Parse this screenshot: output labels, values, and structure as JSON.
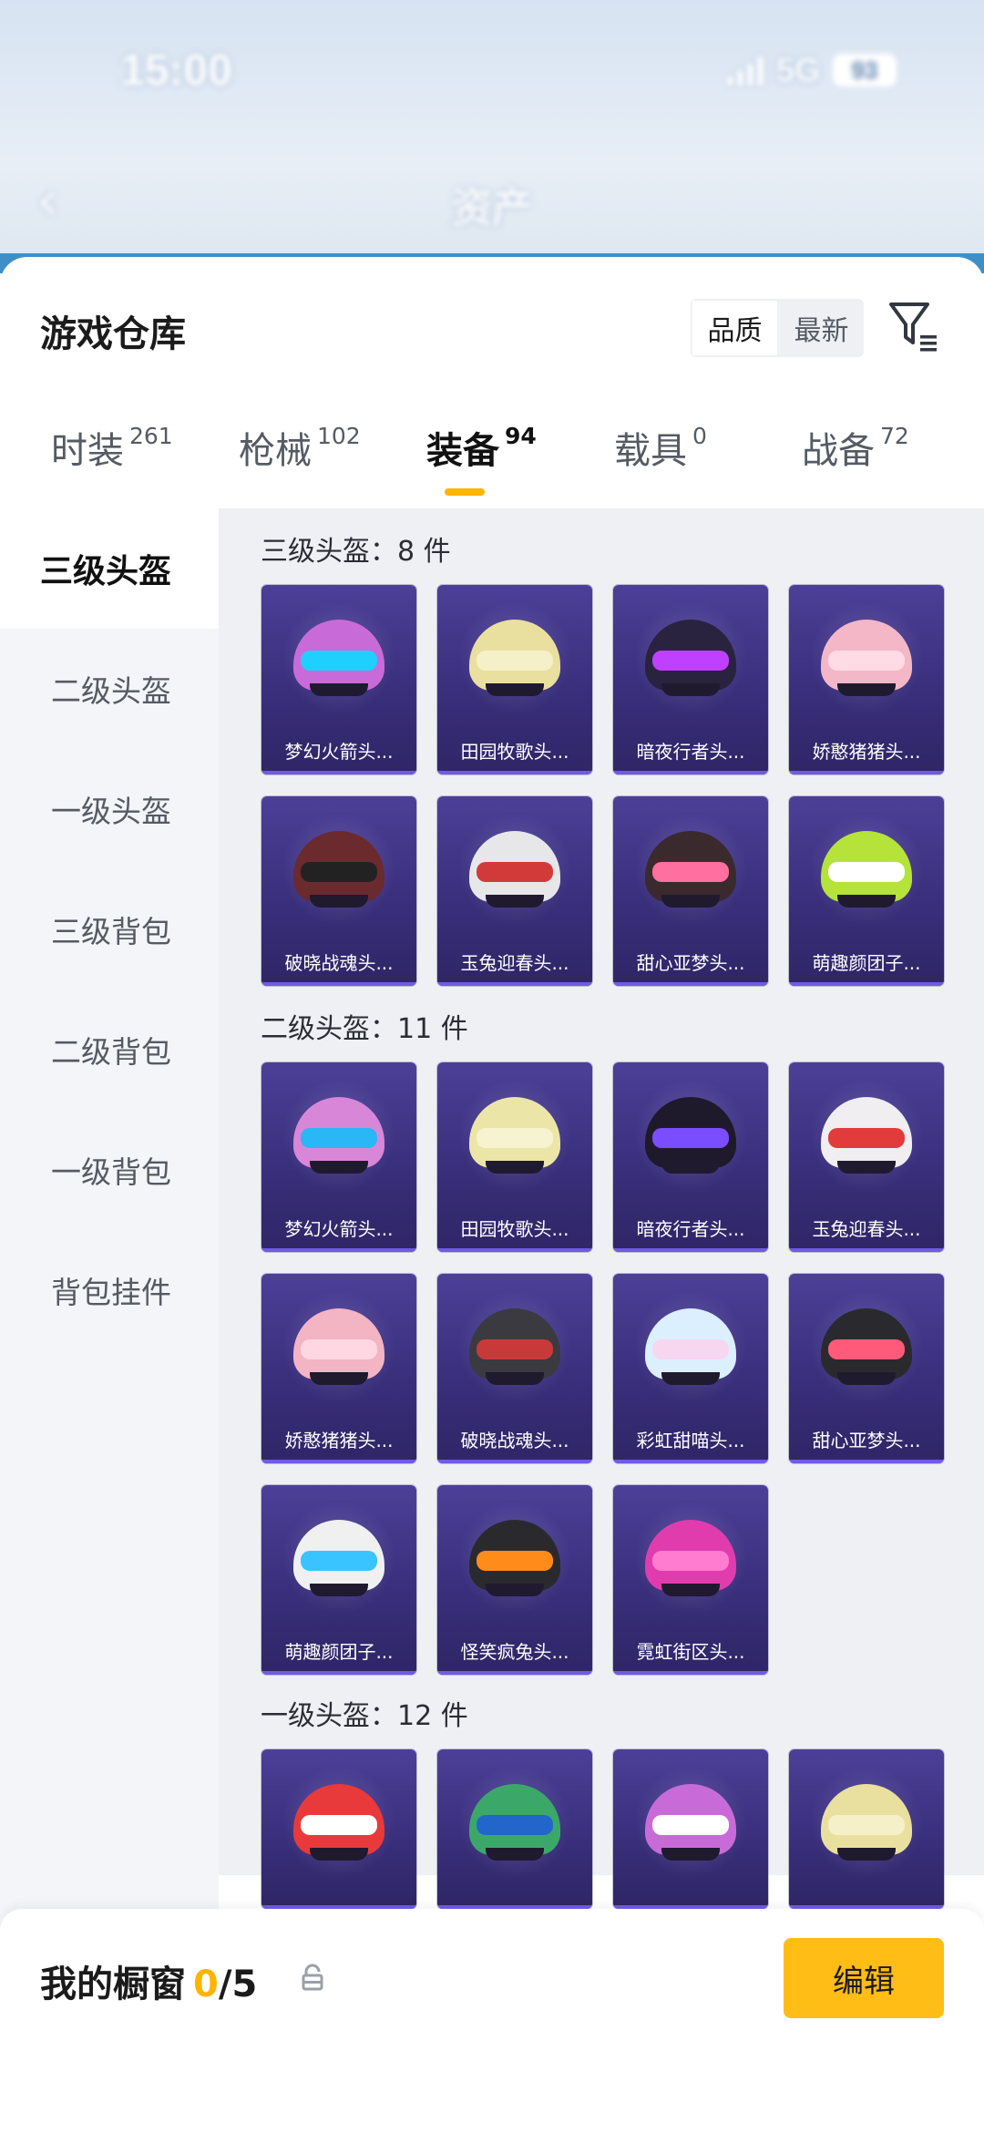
{
  "status_bar": {
    "time": "15:00",
    "network": "5G",
    "battery": "93"
  },
  "nav": {
    "back_glyph": "‹",
    "title": "资产"
  },
  "header": {
    "title": "游戏仓库",
    "sort": {
      "quality": "品质",
      "newest": "最新"
    },
    "filter_icon": "filter-icon"
  },
  "tabs": [
    {
      "label": "时装",
      "count": "261"
    },
    {
      "label": "枪械",
      "count": "102"
    },
    {
      "label": "装备",
      "count": "94"
    },
    {
      "label": "载具",
      "count": "0"
    },
    {
      "label": "战备",
      "count": "72"
    }
  ],
  "categories": [
    "三级头盔",
    "二级头盔",
    "一级头盔",
    "三级背包",
    "二级背包",
    "一级背包",
    "背包挂件"
  ],
  "sections": [
    {
      "title": "三级头盔：8 件",
      "items": [
        "梦幻火箭头...",
        "田园牧歌头...",
        "暗夜行者头...",
        "娇憨猪猪头...",
        "破晓战魂头...",
        "玉兔迎春头...",
        "甜心亚梦头...",
        "萌趣颜团子..."
      ]
    },
    {
      "title": "二级头盔：11 件",
      "items": [
        "梦幻火箭头...",
        "田园牧歌头...",
        "暗夜行者头...",
        "玉兔迎春头...",
        "娇憨猪猪头...",
        "破晓战魂头...",
        "彩虹甜喵头...",
        "甜心亚梦头...",
        "萌趣颜团子...",
        "怪笑疯兔头...",
        "霓虹街区头..."
      ]
    },
    {
      "title": "一级头盔：12 件",
      "items": [
        "",
        "",
        "",
        ""
      ]
    }
  ],
  "showcase": {
    "title": "我的橱窗",
    "used": "0",
    "total": "/5",
    "edit_label": "编辑"
  },
  "colors": {
    "accent": "#ffbd15",
    "card_bg": "#3a2f7c",
    "active_tab_underline": "#ffb400"
  }
}
